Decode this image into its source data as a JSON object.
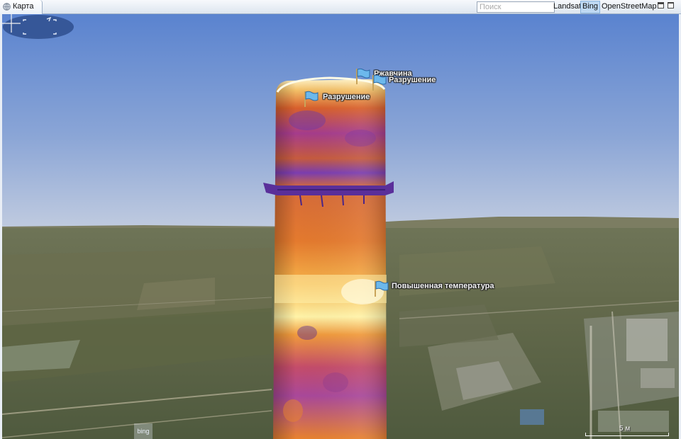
{
  "tab": {
    "title": "Карта",
    "icon": "globe-icon"
  },
  "search": {
    "placeholder": "Поиск",
    "value": ""
  },
  "layers": [
    {
      "label": "Landsat",
      "active": false
    },
    {
      "label": "Bing",
      "active": true
    },
    {
      "label": "OpenStreetMap",
      "active": false
    }
  ],
  "window_buttons": [
    "minimize-icon",
    "restore-icon"
  ],
  "markers": [
    {
      "label": "Ржавчина",
      "icon": "flag-icon"
    },
    {
      "label": "Разрушение",
      "icon": "flag-icon"
    },
    {
      "label": "Разрушение",
      "icon": "flag-icon"
    },
    {
      "label": "Повышенная температура",
      "icon": "flag-icon"
    }
  ],
  "compass": {
    "icon": "compass-icon"
  },
  "crosshair": {
    "icon": "crosshair-icon"
  },
  "attribution": {
    "logo_text": "bing"
  },
  "scale": {
    "label": "5 м"
  },
  "colors": {
    "sky_top": "#5b84d0",
    "sky_bottom": "#b6c4dc",
    "ground": "#5d6447",
    "thermal_hot": "#fff7b0",
    "thermal_mid": "#f07a2a",
    "thermal_cold": "#6b3aa8",
    "active_layer": "#bfd9f3"
  }
}
